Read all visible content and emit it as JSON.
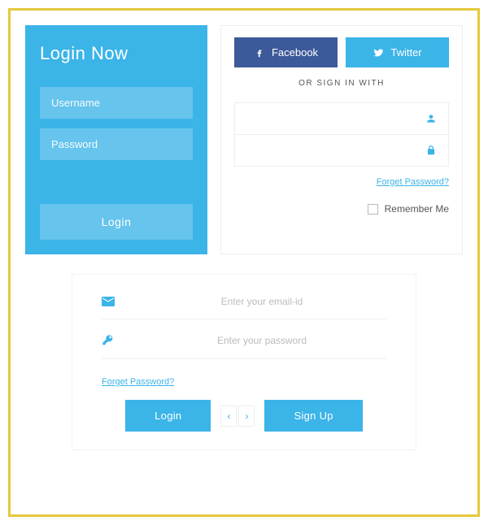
{
  "panel1": {
    "title": "Login Now",
    "username_placeholder": "Username",
    "password_placeholder": "Password",
    "login_label": "Login"
  },
  "panel2": {
    "facebook_label": "Facebook",
    "twitter_label": "Twitter",
    "or_label": "OR SIGN IN WITH",
    "forgot_label": "Forget Password?",
    "remember_label": "Remember Me"
  },
  "panel3": {
    "email_placeholder": "Enter your email-id",
    "password_placeholder": "Enter your password",
    "forgot_label": "Forget Password?",
    "login_label": "Login",
    "signup_label": "Sign Up"
  }
}
